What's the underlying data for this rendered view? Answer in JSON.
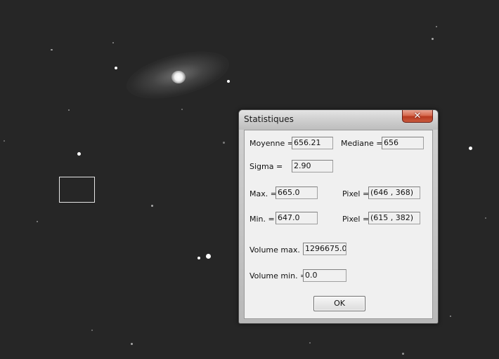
{
  "window": {
    "title": "Statistiques",
    "close_label": "✕"
  },
  "stats": {
    "moyenne_label": "Moyenne =",
    "moyenne_value": "656.21",
    "mediane_label": "Mediane =",
    "mediane_value": "656",
    "sigma_label": "Sigma =",
    "sigma_value": "2.90",
    "max_label": "Max. =",
    "max_value": "665.0",
    "max_pixel_label": "Pixel =",
    "max_pixel_value": "(646 , 368)",
    "min_label": "Min. =",
    "min_value": "647.0",
    "min_pixel_label": "Pixel =",
    "min_pixel_value": "(615 , 382)",
    "volume_max_label": "Volume max. =",
    "volume_max_value": "1296675.0",
    "volume_min_label": "Volume min. =",
    "volume_min_value": "0.0"
  },
  "buttons": {
    "ok_label": "OK"
  }
}
